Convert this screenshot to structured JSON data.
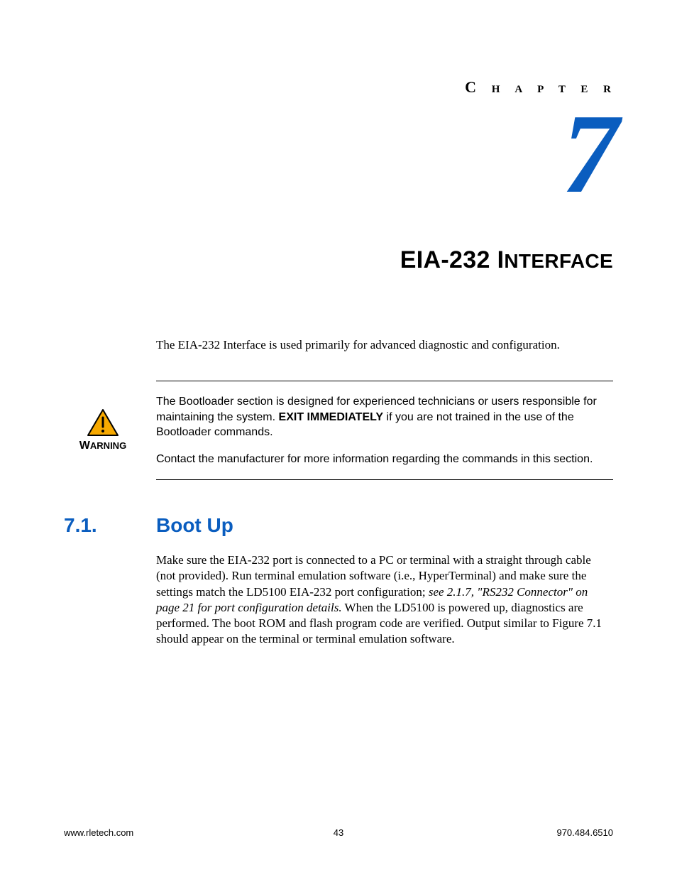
{
  "header": {
    "chapter_word_first": "C",
    "chapter_word_rest": " H A P T E R",
    "chapter_number": "7",
    "title_prefix": "EIA-232 I",
    "title_suffix": "NTERFACE"
  },
  "intro": {
    "text": "The EIA-232 Interface is used primarily for advanced diagnostic and configuration."
  },
  "warning": {
    "label_first": "W",
    "label_rest": "ARNING",
    "p1_a": "The Bootloader section is designed for experienced technicians or users responsible for maintaining the system. ",
    "p1_b": "EXIT IMMEDIATELY",
    "p1_c": " if you are not trained in the use of the Bootloader commands.",
    "p2": "Contact the manufacturer for more information regarding the commands in this section."
  },
  "section": {
    "number": "7.1.",
    "title": "Boot Up",
    "body_a": "Make sure the EIA-232 port is connected to a PC or terminal with a straight through cable (not provided). Run terminal emulation software (i.e., HyperTerminal) and make sure the settings match the LD5100 EIA-232 port configuration; ",
    "body_italic": "see 2.1.7, \"RS232 Connector\" on page 21 for port configuration details.",
    "body_b": " When the LD5100 is powered up, diagnostics are performed. The boot ROM and flash program code are verified. Output similar to Figure 7.1 should appear on the terminal or terminal emulation software."
  },
  "footer": {
    "left": "www.rletech.com",
    "center": "43",
    "right": "970.484.6510"
  },
  "colors": {
    "accent": "#0a5dbf",
    "warn_fill": "#f7a900"
  }
}
